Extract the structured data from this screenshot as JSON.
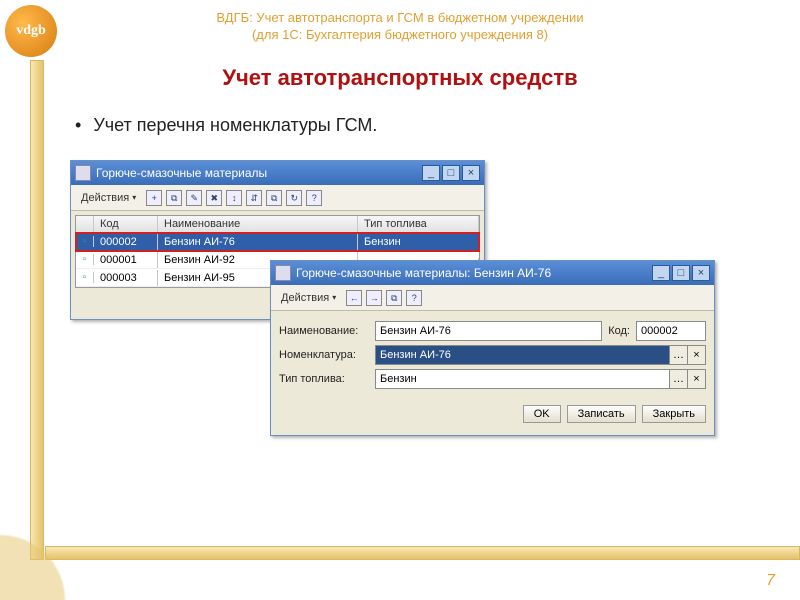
{
  "header": {
    "line1": "ВДГБ: Учет автотранспорта и ГСМ в бюджетном учреждении",
    "line2": "(для 1С: Бухгалтерия бюджетного учреждения 8)",
    "logo": "vdgb"
  },
  "section_title": "Учет автотранспортных средств",
  "bullet_text": "Учет перечня номенклатуры ГСМ.",
  "page_num": "7",
  "win1": {
    "title": "Горюче-смазочные материалы",
    "toolbar_actions": "Действия",
    "cols": {
      "c1": "Код",
      "c2": "Наименование",
      "c3": "Тип топлива"
    },
    "rows": [
      {
        "code": "000002",
        "name": "Бензин АИ-76",
        "fuel": "Бензин"
      },
      {
        "code": "000001",
        "name": "Бензин АИ-92",
        "fuel": ""
      },
      {
        "code": "000003",
        "name": "Бензин АИ-95",
        "fuel": ""
      }
    ]
  },
  "win2": {
    "title": "Горюче-смазочные материалы: Бензин АИ-76",
    "toolbar_actions": "Действия",
    "labels": {
      "name": "Наименование:",
      "code": "Код:",
      "nomen": "Номенклатура:",
      "fuel": "Тип топлива:"
    },
    "values": {
      "name": "Бензин АИ-76",
      "code": "000002",
      "nomen": "Бензин АИ-76",
      "fuel": "Бензин"
    },
    "buttons": {
      "ok": "OK",
      "save": "Записать",
      "close": "Закрыть"
    }
  },
  "icons": {
    "add": "+",
    "addgroup": "⧉",
    "edit": "✎",
    "del": "✖",
    "move": "↕",
    "sort": "⇵",
    "refresh": "↻",
    "help": "?",
    "back": "←",
    "fwd": "→",
    "copy": "⧉"
  }
}
